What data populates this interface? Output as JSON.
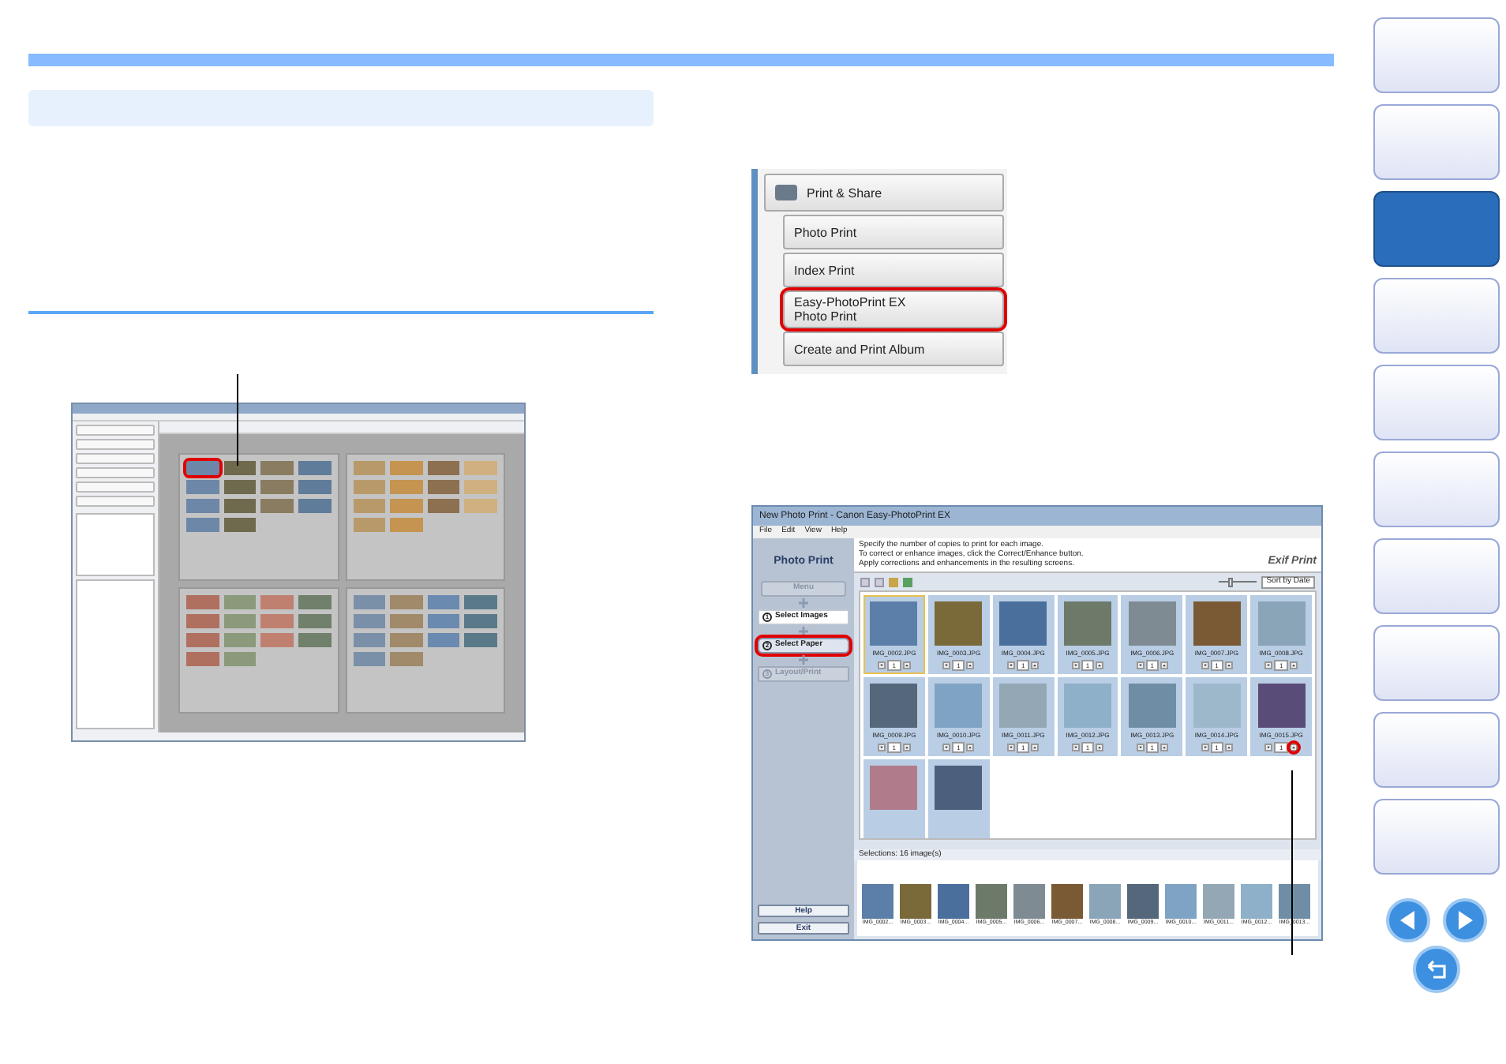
{
  "menu_screenshot": {
    "items": [
      {
        "kind": "header",
        "lines": [
          "Print & Share"
        ],
        "highlighted": false
      },
      {
        "kind": "item",
        "lines": [
          "Photo Print"
        ],
        "highlighted": false
      },
      {
        "kind": "item",
        "lines": [
          "Index Print"
        ],
        "highlighted": false
      },
      {
        "kind": "item",
        "lines": [
          "Easy-PhotoPrint EX",
          "Photo Print"
        ],
        "highlighted": true
      },
      {
        "kind": "item",
        "lines": [
          "Create and Print Album"
        ],
        "highlighted": false
      }
    ]
  },
  "photo_print_window": {
    "title": "New Photo Print - Canon Easy-PhotoPrint EX",
    "menu": [
      "File",
      "Edit",
      "View",
      "Help"
    ],
    "panel_title": "Photo Print",
    "steps": [
      {
        "kind": "button",
        "label": "Menu",
        "enabled": false,
        "selected": false,
        "highlighted": false
      },
      {
        "kind": "step",
        "number": "1",
        "label": "Select Images",
        "enabled": true,
        "selected": true,
        "highlighted": false
      },
      {
        "kind": "step",
        "number": "2",
        "label": "Select Paper",
        "enabled": true,
        "selected": false,
        "highlighted": true
      },
      {
        "kind": "step",
        "number": "3",
        "label": "Layout/Print",
        "enabled": false,
        "selected": false,
        "highlighted": false
      }
    ],
    "instructions": [
      "Specify the number of copies to print for each image.",
      "To correct or enhance images, click the Correct/Enhance button.",
      "Apply corrections and enhancements in the resulting screens."
    ],
    "logo": "Exif Print",
    "sort": "Sort by Date",
    "zoom_level": {
      "level": 0.3
    },
    "images": [
      {
        "name": "IMG_0002.JPG",
        "copies": "1",
        "selected": true,
        "color": "#5b7fa8"
      },
      {
        "name": "IMG_0003.JPG",
        "copies": "1",
        "selected": false,
        "color": "#7a6a3a"
      },
      {
        "name": "IMG_0004.JPG",
        "copies": "1",
        "selected": false,
        "color": "#4a6f9c"
      },
      {
        "name": "IMG_0005.JPG",
        "copies": "1",
        "selected": false,
        "color": "#6d7a6a"
      },
      {
        "name": "IMG_0006.JPG",
        "copies": "1",
        "selected": false,
        "color": "#7f8b92"
      },
      {
        "name": "IMG_0007.JPG",
        "copies": "1",
        "selected": false,
        "color": "#7a5a34"
      },
      {
        "name": "IMG_0008.JPG",
        "copies": "1",
        "selected": false,
        "color": "#8aa4b8"
      },
      {
        "name": "IMG_0009.JPG",
        "copies": "1",
        "selected": false,
        "color": "#55677a"
      },
      {
        "name": "IMG_0010.JPG",
        "copies": "1",
        "selected": false,
        "color": "#7fa3c4"
      },
      {
        "name": "IMG_0011.JPG",
        "copies": "1",
        "selected": false,
        "color": "#93a7b5"
      },
      {
        "name": "IMG_0012.JPG",
        "copies": "1",
        "selected": false,
        "color": "#8eb0c8"
      },
      {
        "name": "IMG_0013.JPG",
        "copies": "1",
        "selected": false,
        "color": "#6f8ea6"
      },
      {
        "name": "IMG_0014.JPG",
        "copies": "1",
        "selected": false,
        "color": "#9db7cb"
      },
      {
        "name": "IMG_0015.JPG",
        "copies": "1",
        "selected": false,
        "color": "#5a4c78"
      },
      {
        "color": "#b07c8c",
        "selected": false
      },
      {
        "color": "#4c5f7c",
        "selected": false
      }
    ],
    "selections_label": "Selections: 16 image(s)",
    "strip": [
      {
        "name": "IMG_0002...",
        "color": "#5b7fa8"
      },
      {
        "name": "IMG_0003...",
        "color": "#7a6a3a"
      },
      {
        "name": "IMG_0004...",
        "color": "#4a6f9c"
      },
      {
        "name": "IMG_0005...",
        "color": "#6d7a6a"
      },
      {
        "name": "IMG_0006...",
        "color": "#7f8b92"
      },
      {
        "name": "IMG_0007...",
        "color": "#7a5a34"
      },
      {
        "name": "IMG_0008...",
        "color": "#8aa4b8"
      },
      {
        "name": "IMG_0009...",
        "color": "#55677a"
      },
      {
        "name": "IMG_0010...",
        "color": "#7fa3c4"
      },
      {
        "name": "IMG_0011...",
        "color": "#93a7b5"
      },
      {
        "name": "IMG_0012...",
        "color": "#8eb0c8"
      },
      {
        "name": "IMG_0013...",
        "color": "#6f8ea6"
      }
    ],
    "buttons": [
      "Help",
      "Exit"
    ]
  },
  "nav_tabs": [
    {
      "selected": false
    },
    {
      "selected": false
    },
    {
      "selected": true
    },
    {
      "selected": false
    },
    {
      "selected": false
    },
    {
      "selected": false
    },
    {
      "selected": false
    },
    {
      "selected": false
    },
    {
      "selected": false
    },
    {
      "selected": false
    }
  ]
}
